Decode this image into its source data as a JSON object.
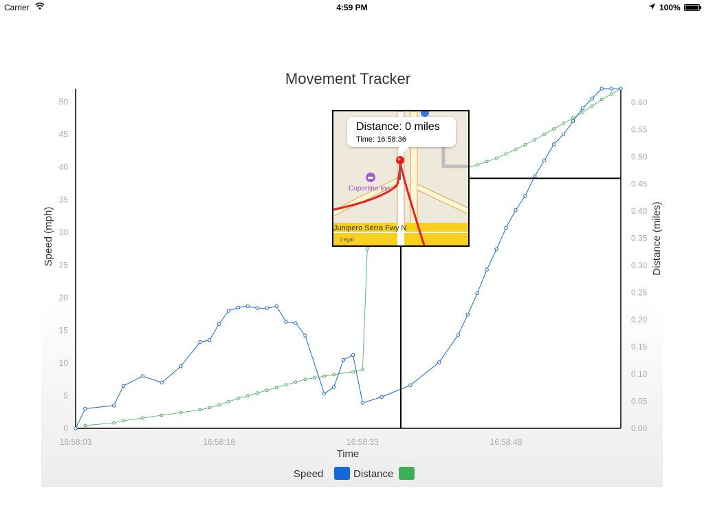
{
  "status_bar": {
    "carrier": "Carrier",
    "time": "4:59 PM",
    "battery": "100%"
  },
  "map_popup": {
    "callout_title": "Distance: 0 miles",
    "callout_subtitle": "Time: 16:58:36",
    "place_label": "Cupertino Inn",
    "road_label": "Junipero Serra Fwy N",
    "legal_label": "Legal"
  },
  "colors": {
    "speed": "#1469d6",
    "distance": "#3cb054",
    "route": "#e8211b",
    "crosshair": "#000000"
  },
  "chart_data": {
    "type": "line",
    "title": "Movement Tracker",
    "xlabel": "Time",
    "ylabel_left": "Speed (mph)",
    "ylabel_right": "Distance (miles)",
    "x_ticks": [
      "16:58:03",
      "16:58:18",
      "16:58:33",
      "16:58:48"
    ],
    "x_tick_seconds": [
      0,
      15,
      30,
      45
    ],
    "xlim_seconds": [
      0,
      57
    ],
    "ylim_left": [
      0,
      52
    ],
    "y_ticks_left": [
      "0",
      "5",
      "10",
      "15",
      "20",
      "25",
      "30",
      "35",
      "40",
      "45",
      "50"
    ],
    "ylim_right": [
      0,
      0.625
    ],
    "y_ticks_right": [
      "0.00",
      "0.05",
      "0.10",
      "0.15",
      "0.20",
      "0.25",
      "0.30",
      "0.35",
      "0.40",
      "0.45",
      "0.50",
      "0.55",
      "0.60"
    ],
    "legend": [
      "Speed",
      "Distance"
    ],
    "legend_position": "bottom",
    "grid": false,
    "crosshair": {
      "time_seconds": 34,
      "distance": 0.46
    },
    "series": [
      {
        "name": "Speed",
        "axis": "left",
        "t": [
          0,
          1,
          4,
          5,
          7,
          9,
          11,
          13,
          14,
          15,
          16,
          17,
          18,
          19,
          20,
          21,
          22,
          23,
          24,
          26,
          27,
          28,
          29,
          30,
          32,
          35,
          38,
          40,
          41,
          42,
          43,
          44,
          45,
          46,
          47,
          48,
          49,
          50,
          51,
          52,
          53,
          54,
          55,
          56,
          57
        ],
        "values": [
          0,
          3,
          3.5,
          6.5,
          8,
          7,
          9.5,
          13.2,
          13.5,
          16,
          18,
          18.5,
          18.7,
          18.4,
          18.4,
          18.7,
          16.3,
          16.1,
          14.2,
          5.3,
          6.3,
          10.5,
          11.2,
          3.9,
          4.8,
          6.6,
          10.1,
          14.3,
          17.4,
          20.7,
          24.3,
          27.4,
          30.7,
          33.4,
          35.6,
          38.6,
          41,
          43.5,
          45,
          47,
          49,
          50.5,
          52,
          52,
          52
        ]
      },
      {
        "name": "Distance",
        "axis": "right",
        "t": [
          1,
          4,
          5,
          7,
          9,
          11,
          13,
          14,
          15,
          16,
          17,
          18,
          19,
          20,
          21,
          22,
          23,
          24,
          25,
          26,
          27,
          29,
          30,
          30.5,
          39,
          40,
          41,
          42,
          43,
          44,
          45,
          46,
          47,
          48,
          49,
          50,
          51,
          52,
          53,
          54,
          55,
          56,
          57
        ],
        "values": [
          0.005,
          0.01,
          0.014,
          0.019,
          0.024,
          0.029,
          0.034,
          0.038,
          0.043,
          0.049,
          0.055,
          0.06,
          0.065,
          0.07,
          0.075,
          0.08,
          0.085,
          0.09,
          0.093,
          0.096,
          0.099,
          0.104,
          0.108,
          0.33,
          0.47,
          0.475,
          0.48,
          0.485,
          0.491,
          0.497,
          0.505,
          0.513,
          0.522,
          0.531,
          0.541,
          0.551,
          0.561,
          0.571,
          0.582,
          0.593,
          0.605,
          0.615,
          0.625
        ]
      }
    ]
  }
}
